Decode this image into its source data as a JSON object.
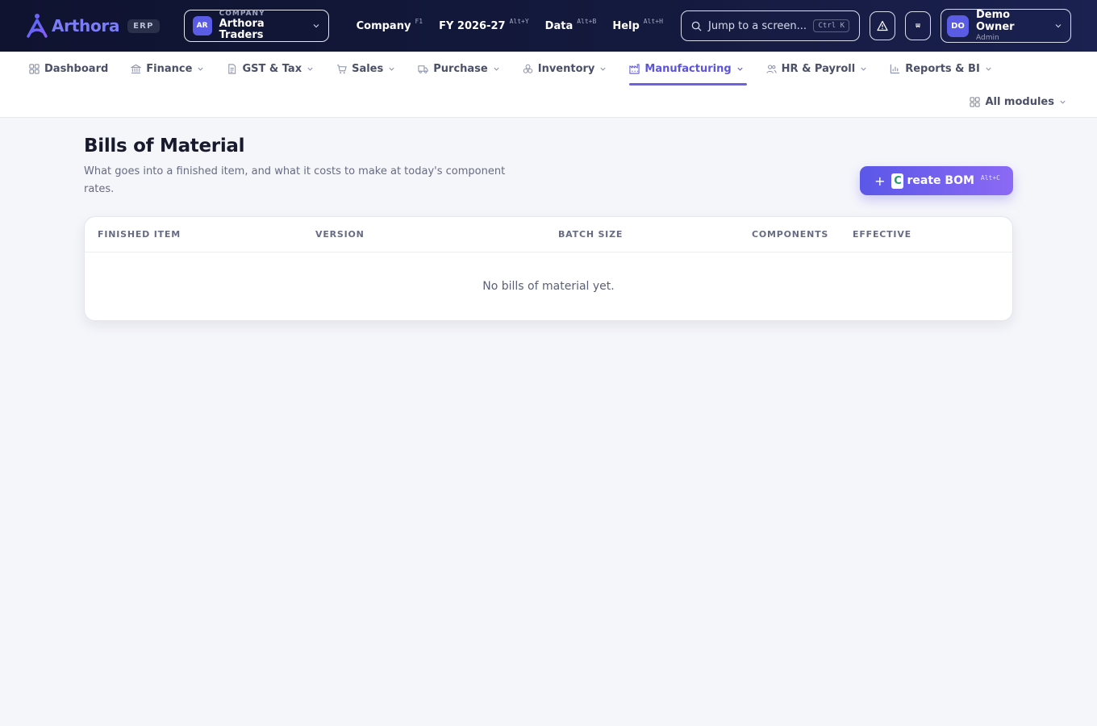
{
  "brand": {
    "name": "Arthora",
    "badge": "ERP"
  },
  "company_switch": {
    "initials": "AR",
    "label": "COMPANY",
    "name": "Arthora Traders"
  },
  "top_menu": [
    {
      "label": "Company",
      "shortcut": "F1"
    },
    {
      "label": "FY 2026-27",
      "shortcut": "Alt+Y"
    },
    {
      "label": "Data",
      "shortcut": "Alt+B"
    },
    {
      "label": "Help",
      "shortcut": "Alt+H"
    }
  ],
  "search": {
    "placeholder": "Jump to a screen...",
    "shortcut": "Ctrl K"
  },
  "user": {
    "initials": "DO",
    "name": "Demo Owner",
    "role": "Admin"
  },
  "modules": [
    {
      "label": "Dashboard",
      "icon": "grid-icon",
      "dropdown": false,
      "active": false
    },
    {
      "label": "Finance",
      "icon": "bank-icon",
      "dropdown": true,
      "active": false
    },
    {
      "label": "GST & Tax",
      "icon": "document-icon",
      "dropdown": true,
      "active": false
    },
    {
      "label": "Sales",
      "icon": "cart-icon",
      "dropdown": true,
      "active": false
    },
    {
      "label": "Purchase",
      "icon": "truck-icon",
      "dropdown": true,
      "active": false
    },
    {
      "label": "Inventory",
      "icon": "boxes-icon",
      "dropdown": true,
      "active": false
    },
    {
      "label": "Manufacturing",
      "icon": "factory-icon",
      "dropdown": true,
      "active": true
    },
    {
      "label": "HR & Payroll",
      "icon": "users-icon",
      "dropdown": true,
      "active": false
    },
    {
      "label": "Reports & BI",
      "icon": "bar-chart-icon",
      "dropdown": true,
      "active": false
    }
  ],
  "all_modules": {
    "label": "All modules",
    "icon": "grid-icon"
  },
  "page": {
    "title": "Bills of Material",
    "subtitle": "What goes into a finished item, and what it costs to make at today's component rates."
  },
  "create_button": {
    "key": "C",
    "label": "reate BOM",
    "shortcut": "Alt+C"
  },
  "table": {
    "columns": [
      "FINISHED ITEM",
      "VERSION",
      "BATCH SIZE",
      "COMPONENTS",
      "EFFECTIVE"
    ],
    "empty_text": "No bills of material yet."
  },
  "colors": {
    "accent": "#5d55d8",
    "topbar": "#0f1330",
    "background": "#f5f6fa"
  }
}
